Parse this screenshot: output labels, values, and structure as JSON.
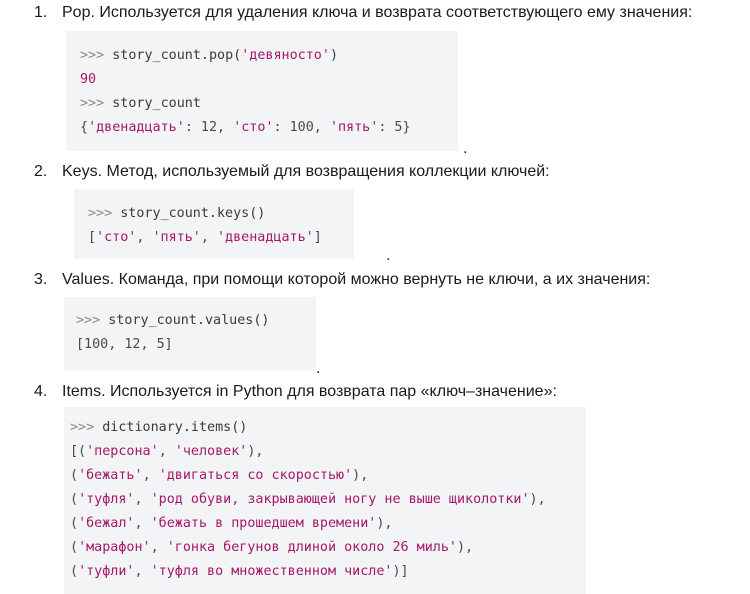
{
  "items": [
    {
      "number": "1.",
      "text": "Pop. Используется для удаления ключа и возврата соответствующего ему значения:",
      "code": [
        [
          {
            "t": ">>> ",
            "c": "prompt"
          },
          {
            "t": "story_count.pop(",
            "c": "name"
          },
          {
            "t": "'девяносто'",
            "c": "str"
          },
          {
            "t": ")",
            "c": "name"
          }
        ],
        [
          {
            "t": "90",
            "c": "num-val"
          }
        ],
        [
          {
            "t": ">>> ",
            "c": "prompt"
          },
          {
            "t": "story_count",
            "c": "name"
          }
        ],
        [
          {
            "t": "{",
            "c": "punc"
          },
          {
            "t": "'двенадцать'",
            "c": "str"
          },
          {
            "t": ": 12, ",
            "c": "punc"
          },
          {
            "t": "'сто'",
            "c": "str"
          },
          {
            "t": ": 100, ",
            "c": "punc"
          },
          {
            "t": "'пять'",
            "c": "str"
          },
          {
            "t": ": 5}",
            "c": "punc"
          }
        ]
      ],
      "trailing": "."
    },
    {
      "number": "2.",
      "text": "Keys. Метод, используемый для возвращения коллекции ключей:",
      "code": [
        [
          {
            "t": ">>> ",
            "c": "prompt"
          },
          {
            "t": "story_count.keys()",
            "c": "name"
          }
        ],
        [
          {
            "t": "[",
            "c": "punc"
          },
          {
            "t": "'сто'",
            "c": "str"
          },
          {
            "t": ", ",
            "c": "punc"
          },
          {
            "t": "'пять'",
            "c": "str"
          },
          {
            "t": ", ",
            "c": "punc"
          },
          {
            "t": "'двенадцать'",
            "c": "str"
          },
          {
            "t": "]",
            "c": "punc"
          }
        ]
      ],
      "trailing": "."
    },
    {
      "number": "3.",
      "text": "Values. Команда, при помощи которой можно вернуть не ключи, а их значения:",
      "code": [
        [
          {
            "t": ">>> ",
            "c": "prompt"
          },
          {
            "t": "story_count.values()",
            "c": "name"
          }
        ],
        [
          {
            "t": "[100, 12, 5]",
            "c": "punc"
          }
        ]
      ],
      "trailing": "."
    },
    {
      "number": "4.",
      "text": "Items. Используется in Python для возврата пар «ключ–значение»:",
      "code": [
        [
          {
            "t": ">>> ",
            "c": "prompt"
          },
          {
            "t": "dictionary.items()",
            "c": "name"
          }
        ],
        [
          {
            "t": "[(",
            "c": "punc"
          },
          {
            "t": "'персона'",
            "c": "str"
          },
          {
            "t": ", ",
            "c": "punc"
          },
          {
            "t": "'человек'",
            "c": "str"
          },
          {
            "t": "),",
            "c": "punc"
          }
        ],
        [
          {
            "t": "(",
            "c": "punc"
          },
          {
            "t": "'бежать'",
            "c": "str"
          },
          {
            "t": ", ",
            "c": "punc"
          },
          {
            "t": "'двигаться со скоростью'",
            "c": "str"
          },
          {
            "t": "),",
            "c": "punc"
          }
        ],
        [
          {
            "t": "(",
            "c": "punc"
          },
          {
            "t": "'туфля'",
            "c": "str"
          },
          {
            "t": ", ",
            "c": "punc"
          },
          {
            "t": "'род обуви, закрывающей ногу не выше щиколотки'",
            "c": "str"
          },
          {
            "t": "),",
            "c": "punc"
          }
        ],
        [
          {
            "t": "(",
            "c": "punc"
          },
          {
            "t": "'бежал'",
            "c": "str"
          },
          {
            "t": ", ",
            "c": "punc"
          },
          {
            "t": "'бежать в прошедшем времени'",
            "c": "str"
          },
          {
            "t": "),",
            "c": "punc"
          }
        ],
        [
          {
            "t": "(",
            "c": "punc"
          },
          {
            "t": "'марафон'",
            "c": "str"
          },
          {
            "t": ", ",
            "c": "punc"
          },
          {
            "t": "'гонка бегунов длиной около 26 миль'",
            "c": "str"
          },
          {
            "t": "),",
            "c": "punc"
          }
        ],
        [
          {
            "t": "(",
            "c": "punc"
          },
          {
            "t": "'туфли'",
            "c": "str"
          },
          {
            "t": ", ",
            "c": "punc"
          },
          {
            "t": "'туфля во множественном числе'",
            "c": "str"
          },
          {
            "t": ")]",
            "c": "punc"
          }
        ]
      ],
      "trailing": ""
    }
  ]
}
